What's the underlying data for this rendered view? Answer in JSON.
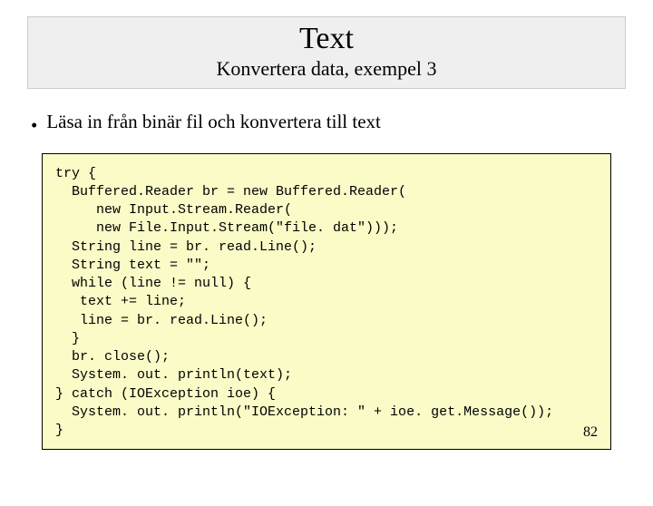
{
  "header": {
    "title": "Text",
    "subtitle": "Konvertera data, exempel 3"
  },
  "bullet": {
    "marker": "•",
    "text": "Läsa in från binär fil och konvertera till text"
  },
  "code": {
    "lines": "try {\n  Buffered.Reader br = new Buffered.Reader(\n     new Input.Stream.Reader(\n     new File.Input.Stream(\"file. dat\")));\n  String line = br. read.Line();\n  String text = \"\";\n  while (line != null) {\n   text += line;\n   line = br. read.Line();\n  }\n  br. close();\n  System. out. println(text);\n} catch (IOException ioe) {\n  System. out. println(\"IOException: \" + ioe. get.Message());\n}"
  },
  "slide_number": "82"
}
